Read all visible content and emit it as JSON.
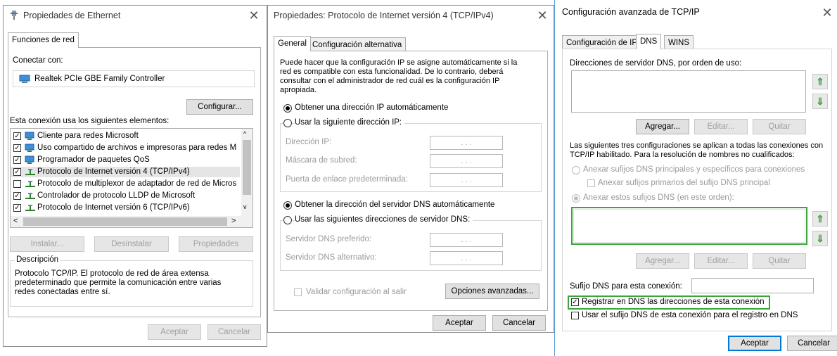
{
  "eth": {
    "title": "Propiedades de Ethernet",
    "tab": "Funciones de red",
    "connect_label": "Conectar con:",
    "adapter": "Realtek PCIe GBE Family Controller",
    "configure": "Configurar...",
    "elements_label": "Esta conexión usa los siguientes elementos:",
    "items": [
      {
        "label": "Cliente para redes Microsoft",
        "checked": true
      },
      {
        "label": "Uso compartido de archivos e impresoras para redes M",
        "checked": true
      },
      {
        "label": "Programador de paquetes QoS",
        "checked": true
      },
      {
        "label": "Protocolo de Internet versión 4 (TCP/IPv4)",
        "checked": true
      },
      {
        "label": "Protocolo de multiplexor de adaptador de red de Micros",
        "checked": false
      },
      {
        "label": "Controlador de protocolo LLDP de Microsoft",
        "checked": true
      },
      {
        "label": "Protocolo de Internet versión 6 (TCP/IPv6)",
        "checked": true
      }
    ],
    "install": "Instalar...",
    "uninstall": "Desinstalar",
    "properties": "Propiedades",
    "desc_legend": "Descripción",
    "desc_text": [
      "Protocolo TCP/IP. El protocolo de red de área extensa",
      "predeterminado que permite la comunicación entre varias",
      "redes conectadas entre sí."
    ],
    "ok": "Aceptar",
    "cancel": "Cancelar"
  },
  "ipv4": {
    "title": "Propiedades: Protocolo de Internet versión 4 (TCP/IPv4)",
    "tabs": [
      "General",
      "Configuración alternativa"
    ],
    "intro": [
      "Puede hacer que la configuración IP se asigne automáticamente si la",
      "red es compatible con esta funcionalidad. De lo contrario, deberá",
      "consultar con el administrador de red cuál es la configuración IP",
      "apropiada."
    ],
    "auto_ip": "Obtener una dirección IP automáticamente",
    "manual_ip": "Usar la siguiente dirección IP:",
    "ip_label": "Dirección IP:",
    "mask_label": "Máscara de subred:",
    "gateway_label": "Puerta de enlace predeterminada:",
    "ip_placeholder": ".        .        .",
    "auto_dns": "Obtener la dirección del servidor DNS automáticamente",
    "manual_dns": "Usar las siguientes direcciones de servidor DNS:",
    "pref_dns": "Servidor DNS preferido:",
    "alt_dns": "Servidor DNS alternativo:",
    "validate": "Validar configuración al salir",
    "advanced": "Opciones avanzadas...",
    "ok": "Aceptar",
    "cancel": "Cancelar"
  },
  "adv": {
    "title": "Configuración avanzada de TCP/IP",
    "tabs": [
      "Configuración de IP",
      "DNS",
      "WINS"
    ],
    "dns_servers_label": "Direcciones de servidor DNS, por orden de uso:",
    "add": "Agregar...",
    "edit": "Editar...",
    "remove": "Quitar",
    "info": [
      "Las siguientes tres configuraciones se aplican a todas las conexiones con",
      "TCP/IP habilitado. Para la resolución de nombres no cualificados:"
    ],
    "append_primary": "Anexar sufijos DNS principales y específicos para conexiones",
    "append_parent": "Anexar sufijos primarios del sufijo DNS principal",
    "append_these": "Anexar estos sufijos DNS (en este orden):",
    "suffix_label": "Sufijo DNS para esta conexión:",
    "suffix_value": "",
    "register": "Registrar en DNS las direcciones de esta conexión",
    "use_suffix": "Usar el sufijo DNS de esta conexión para el registro en DNS",
    "ok": "Aceptar",
    "cancel": "Cancelar"
  },
  "colors": {
    "accent": "#0078d7",
    "highlight": "#3aa63a",
    "arrow": "#3a9c3a"
  }
}
